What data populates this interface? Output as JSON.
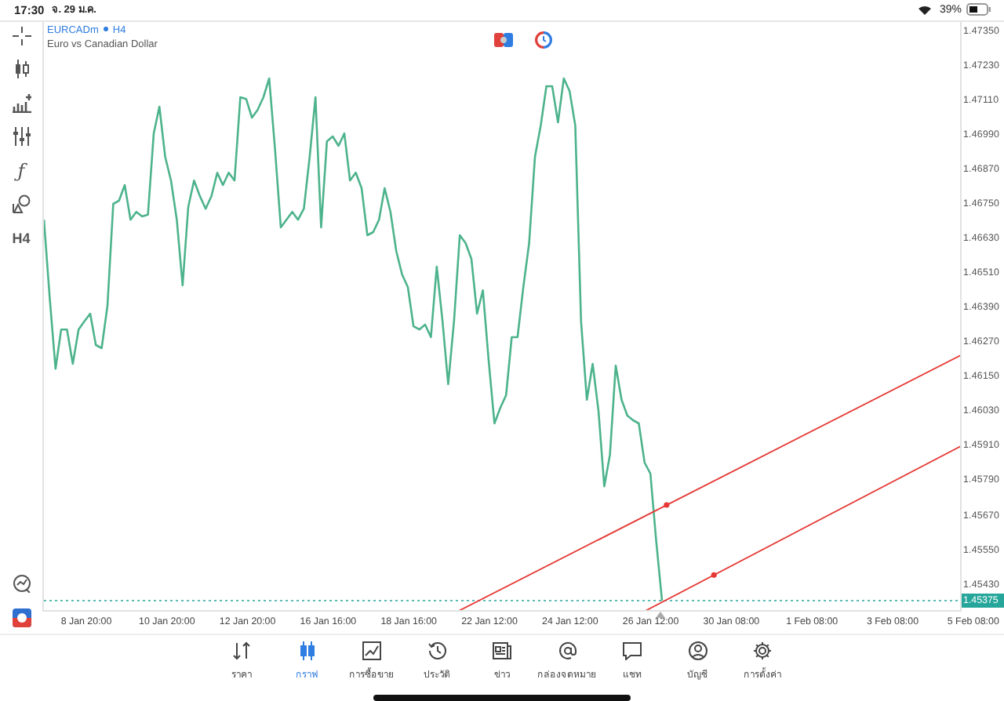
{
  "status_bar": {
    "time": "17:30",
    "date": "จ. 29 ม.ค.",
    "battery": "39%"
  },
  "toolbar": [
    {
      "kind": "crosshair"
    },
    {
      "kind": "candles"
    },
    {
      "kind": "indicators"
    },
    {
      "kind": "sliders"
    },
    {
      "kind": "text",
      "label": "ƒ"
    },
    {
      "kind": "objects"
    },
    {
      "kind": "text",
      "label": "H4"
    }
  ],
  "toolbar_bottom": [
    {
      "kind": "chart-check"
    },
    {
      "kind": "logo"
    }
  ],
  "chart": {
    "symbol": "EURCADm",
    "timeframe": "H4",
    "description": "Euro vs Canadian Dollar",
    "time_labels": [
      "8 Jan 20:00",
      "10 Jan 20:00",
      "12 Jan 20:00",
      "16 Jan 16:00",
      "18 Jan 16:00",
      "22 Jan 12:00",
      "24 Jan 12:00",
      "26 Jan 12:00",
      "30 Jan 08:00",
      "1 Feb 08:00",
      "3 Feb 08:00",
      "5 Feb 08:00"
    ],
    "chart_data": {
      "type": "line",
      "ylim": [
        1.45337,
        1.47383
      ],
      "ref_lines": [
        {
          "axis": "y",
          "value": 1.45375,
          "label": "1.45375",
          "color": "#26a69a"
        }
      ],
      "series": [
        {
          "color": "#4db38c",
          "values": [
            1.46697,
            1.46425,
            1.4618,
            1.46316,
            1.46316,
            1.46197,
            1.46316,
            1.46344,
            1.46371,
            1.46262,
            1.46251,
            1.46398,
            1.46752,
            1.46763,
            1.46817,
            1.46697,
            1.46724,
            1.46708,
            1.46714,
            1.46996,
            1.47089,
            1.46915,
            1.46833,
            1.46697,
            1.46469,
            1.46741,
            1.46833,
            1.46779,
            1.46735,
            1.46779,
            1.4686,
            1.46817,
            1.4686,
            1.46833,
            1.47122,
            1.47116,
            1.47051,
            1.47078,
            1.47122,
            1.47187,
            1.46942,
            1.4667,
            1.46697,
            1.46724,
            1.46697,
            1.46735,
            1.46915,
            1.47122,
            1.4667,
            1.46969,
            1.46986,
            1.46953,
            1.46996,
            1.46833,
            1.4686,
            1.46806,
            1.46643,
            1.46654,
            1.46697,
            1.46806,
            1.46724,
            1.46588,
            1.46507,
            1.46463,
            1.46327,
            1.46316,
            1.46333,
            1.46289,
            1.46534,
            1.46344,
            1.46126,
            1.46344,
            1.46643,
            1.46616,
            1.46561,
            1.46371,
            1.46452,
            1.46208,
            1.4599,
            1.46044,
            1.46088,
            1.46289,
            1.46289,
            1.46463,
            1.46616,
            1.46915,
            1.47024,
            1.4716,
            1.4716,
            1.47035,
            1.47187,
            1.47143,
            1.47024,
            1.46344,
            1.46072,
            1.46197,
            1.46034,
            1.45772,
            1.45881,
            1.46191,
            1.46072,
            1.46017,
            1.46001,
            1.4599,
            1.45854,
            1.45816,
            1.45582,
            1.45375
          ]
        }
      ],
      "yticks": [
        {
          "value": 1.4735,
          "label": "1.47350"
        },
        {
          "value": 1.4723,
          "label": "1.47230"
        },
        {
          "value": 1.4711,
          "label": "1.47110"
        },
        {
          "value": 1.4699,
          "label": "1.46990"
        },
        {
          "value": 1.4687,
          "label": "1.46870"
        },
        {
          "value": 1.4675,
          "label": "1.46750"
        },
        {
          "value": 1.4663,
          "label": "1.46630"
        },
        {
          "value": 1.4651,
          "label": "1.46510"
        },
        {
          "value": 1.4639,
          "label": "1.46390"
        },
        {
          "value": 1.4627,
          "label": "1.46270"
        },
        {
          "value": 1.4615,
          "label": "1.46150"
        },
        {
          "value": 1.4603,
          "label": "1.46030"
        },
        {
          "value": 1.4591,
          "label": "1.45910"
        },
        {
          "value": 1.4579,
          "label": "1.45790"
        },
        {
          "value": 1.4567,
          "label": "1.45670"
        },
        {
          "value": 1.4555,
          "label": "1.45550"
        },
        {
          "value": 1.4543,
          "label": "1.45430"
        }
      ]
    }
  },
  "nav": [
    {
      "kind": "quotes",
      "label": "ราคา",
      "selected": false
    },
    {
      "kind": "chart",
      "label": "กราฟ",
      "selected": true
    },
    {
      "kind": "trade",
      "label": "การซื้อขาย",
      "selected": false
    },
    {
      "kind": "history",
      "label": "ประวัติ",
      "selected": false
    },
    {
      "kind": "news",
      "label": "ข่าว",
      "selected": false
    },
    {
      "kind": "mail",
      "label": "กล่องจดหมาย",
      "selected": false
    },
    {
      "kind": "chat",
      "label": "แชท",
      "selected": false
    },
    {
      "kind": "account",
      "label": "บัญชี",
      "selected": false
    },
    {
      "kind": "settings",
      "label": "การตั้งค่า",
      "selected": false
    }
  ]
}
